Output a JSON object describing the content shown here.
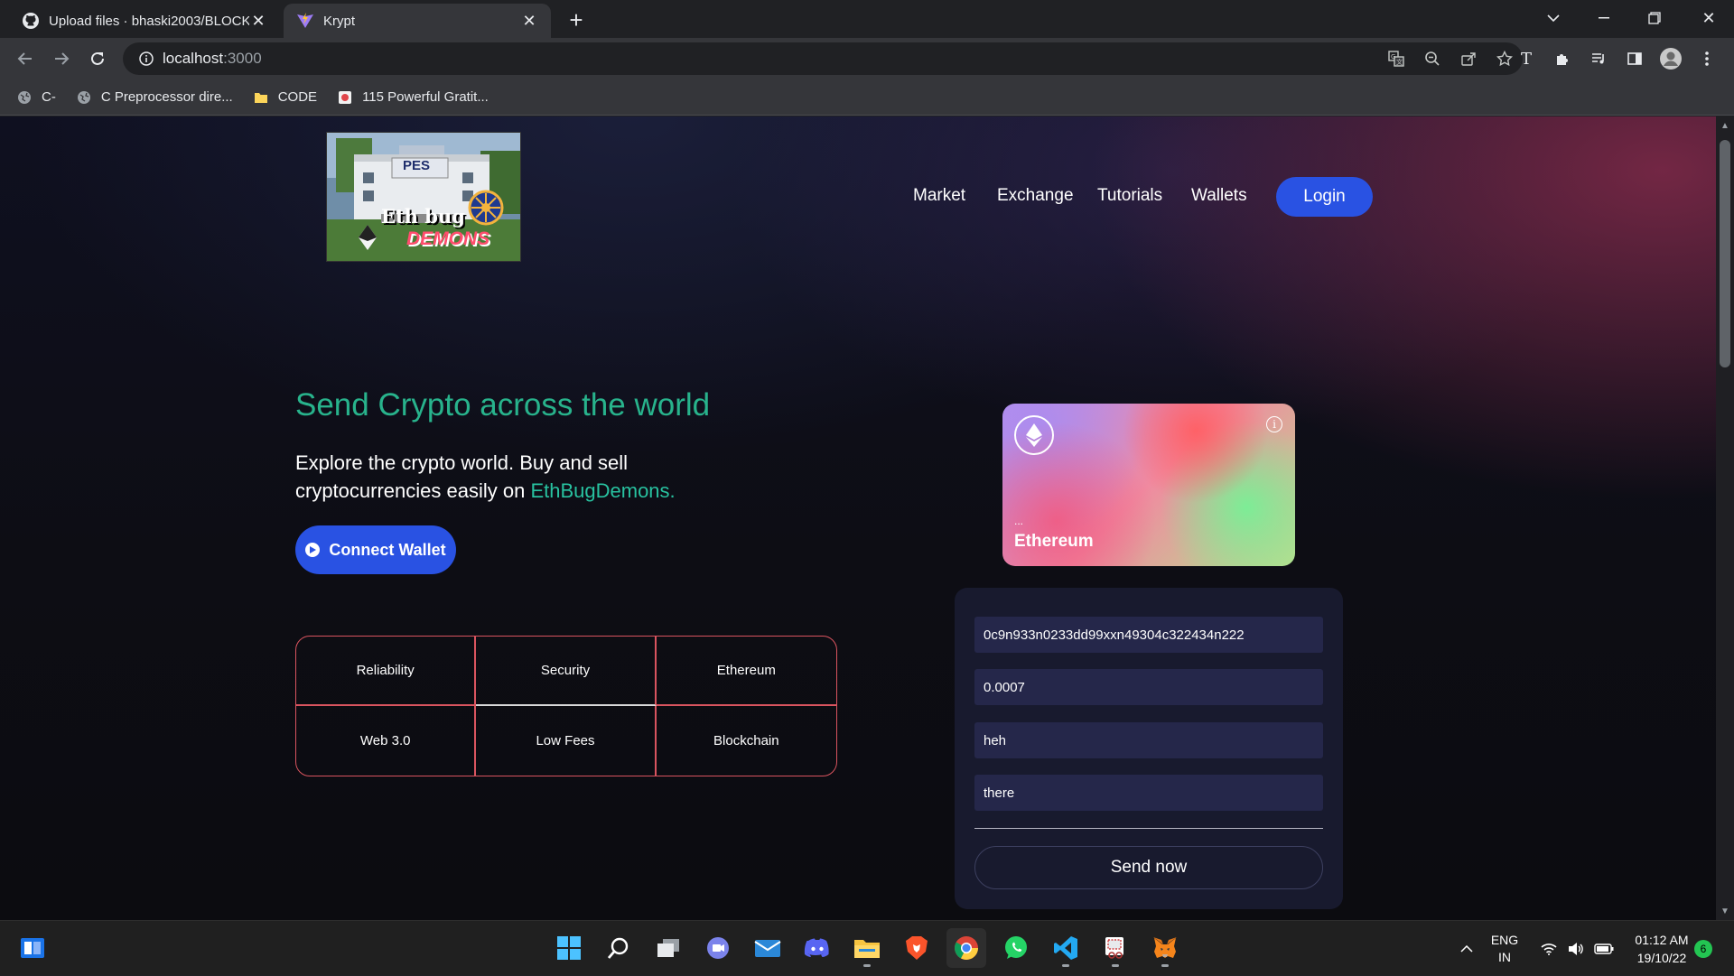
{
  "browser": {
    "tabs": [
      {
        "title": "Upload files · bhaski2003/BLOCKCHAIN",
        "favicon": "github-icon",
        "active": false
      },
      {
        "title": "Krypt",
        "favicon": "vite-icon",
        "active": true
      }
    ],
    "address": {
      "host": "localhost",
      "port": ":3000"
    },
    "bookmarks": [
      {
        "label": "C-",
        "icon": "globe-icon"
      },
      {
        "label": "C Preprocessor dire...",
        "icon": "globe-icon"
      },
      {
        "label": "CODE",
        "icon": "folder-icon"
      },
      {
        "label": "115 Powerful Gratit...",
        "icon": "site-icon"
      }
    ]
  },
  "site": {
    "logo": {
      "top_text": "PES",
      "line1": "Eth bug",
      "line2": "DEMONS"
    },
    "nav": [
      "Market",
      "Exchange",
      "Tutorials",
      "Wallets"
    ],
    "login_label": "Login",
    "hero": {
      "title": "Send Crypto across the world",
      "desc_prefix": "Explore the crypto world. Buy and sell cryptocurrencies easily on ",
      "brand": "EthBugDemons."
    },
    "connect_label": "Connect Wallet",
    "features": [
      "Reliability",
      "Security",
      "Ethereum",
      "Web 3.0",
      "Low Fees",
      "Blockchain"
    ],
    "card": {
      "address": "...",
      "network": "Ethereum"
    },
    "form": {
      "address": "0c9n933n0233dd99xxn49304c322434n222",
      "amount": "0.0007",
      "keyword": "heh",
      "message": "there",
      "send_label": "Send now"
    }
  },
  "taskbar": {
    "language": [
      "ENG",
      "IN"
    ],
    "time": "01:12 AM",
    "date": "19/10/22",
    "notifications": "6"
  },
  "colors": {
    "accent": "#2952e3",
    "brand_green": "#28b38c",
    "grid_border": "#d9545f"
  }
}
